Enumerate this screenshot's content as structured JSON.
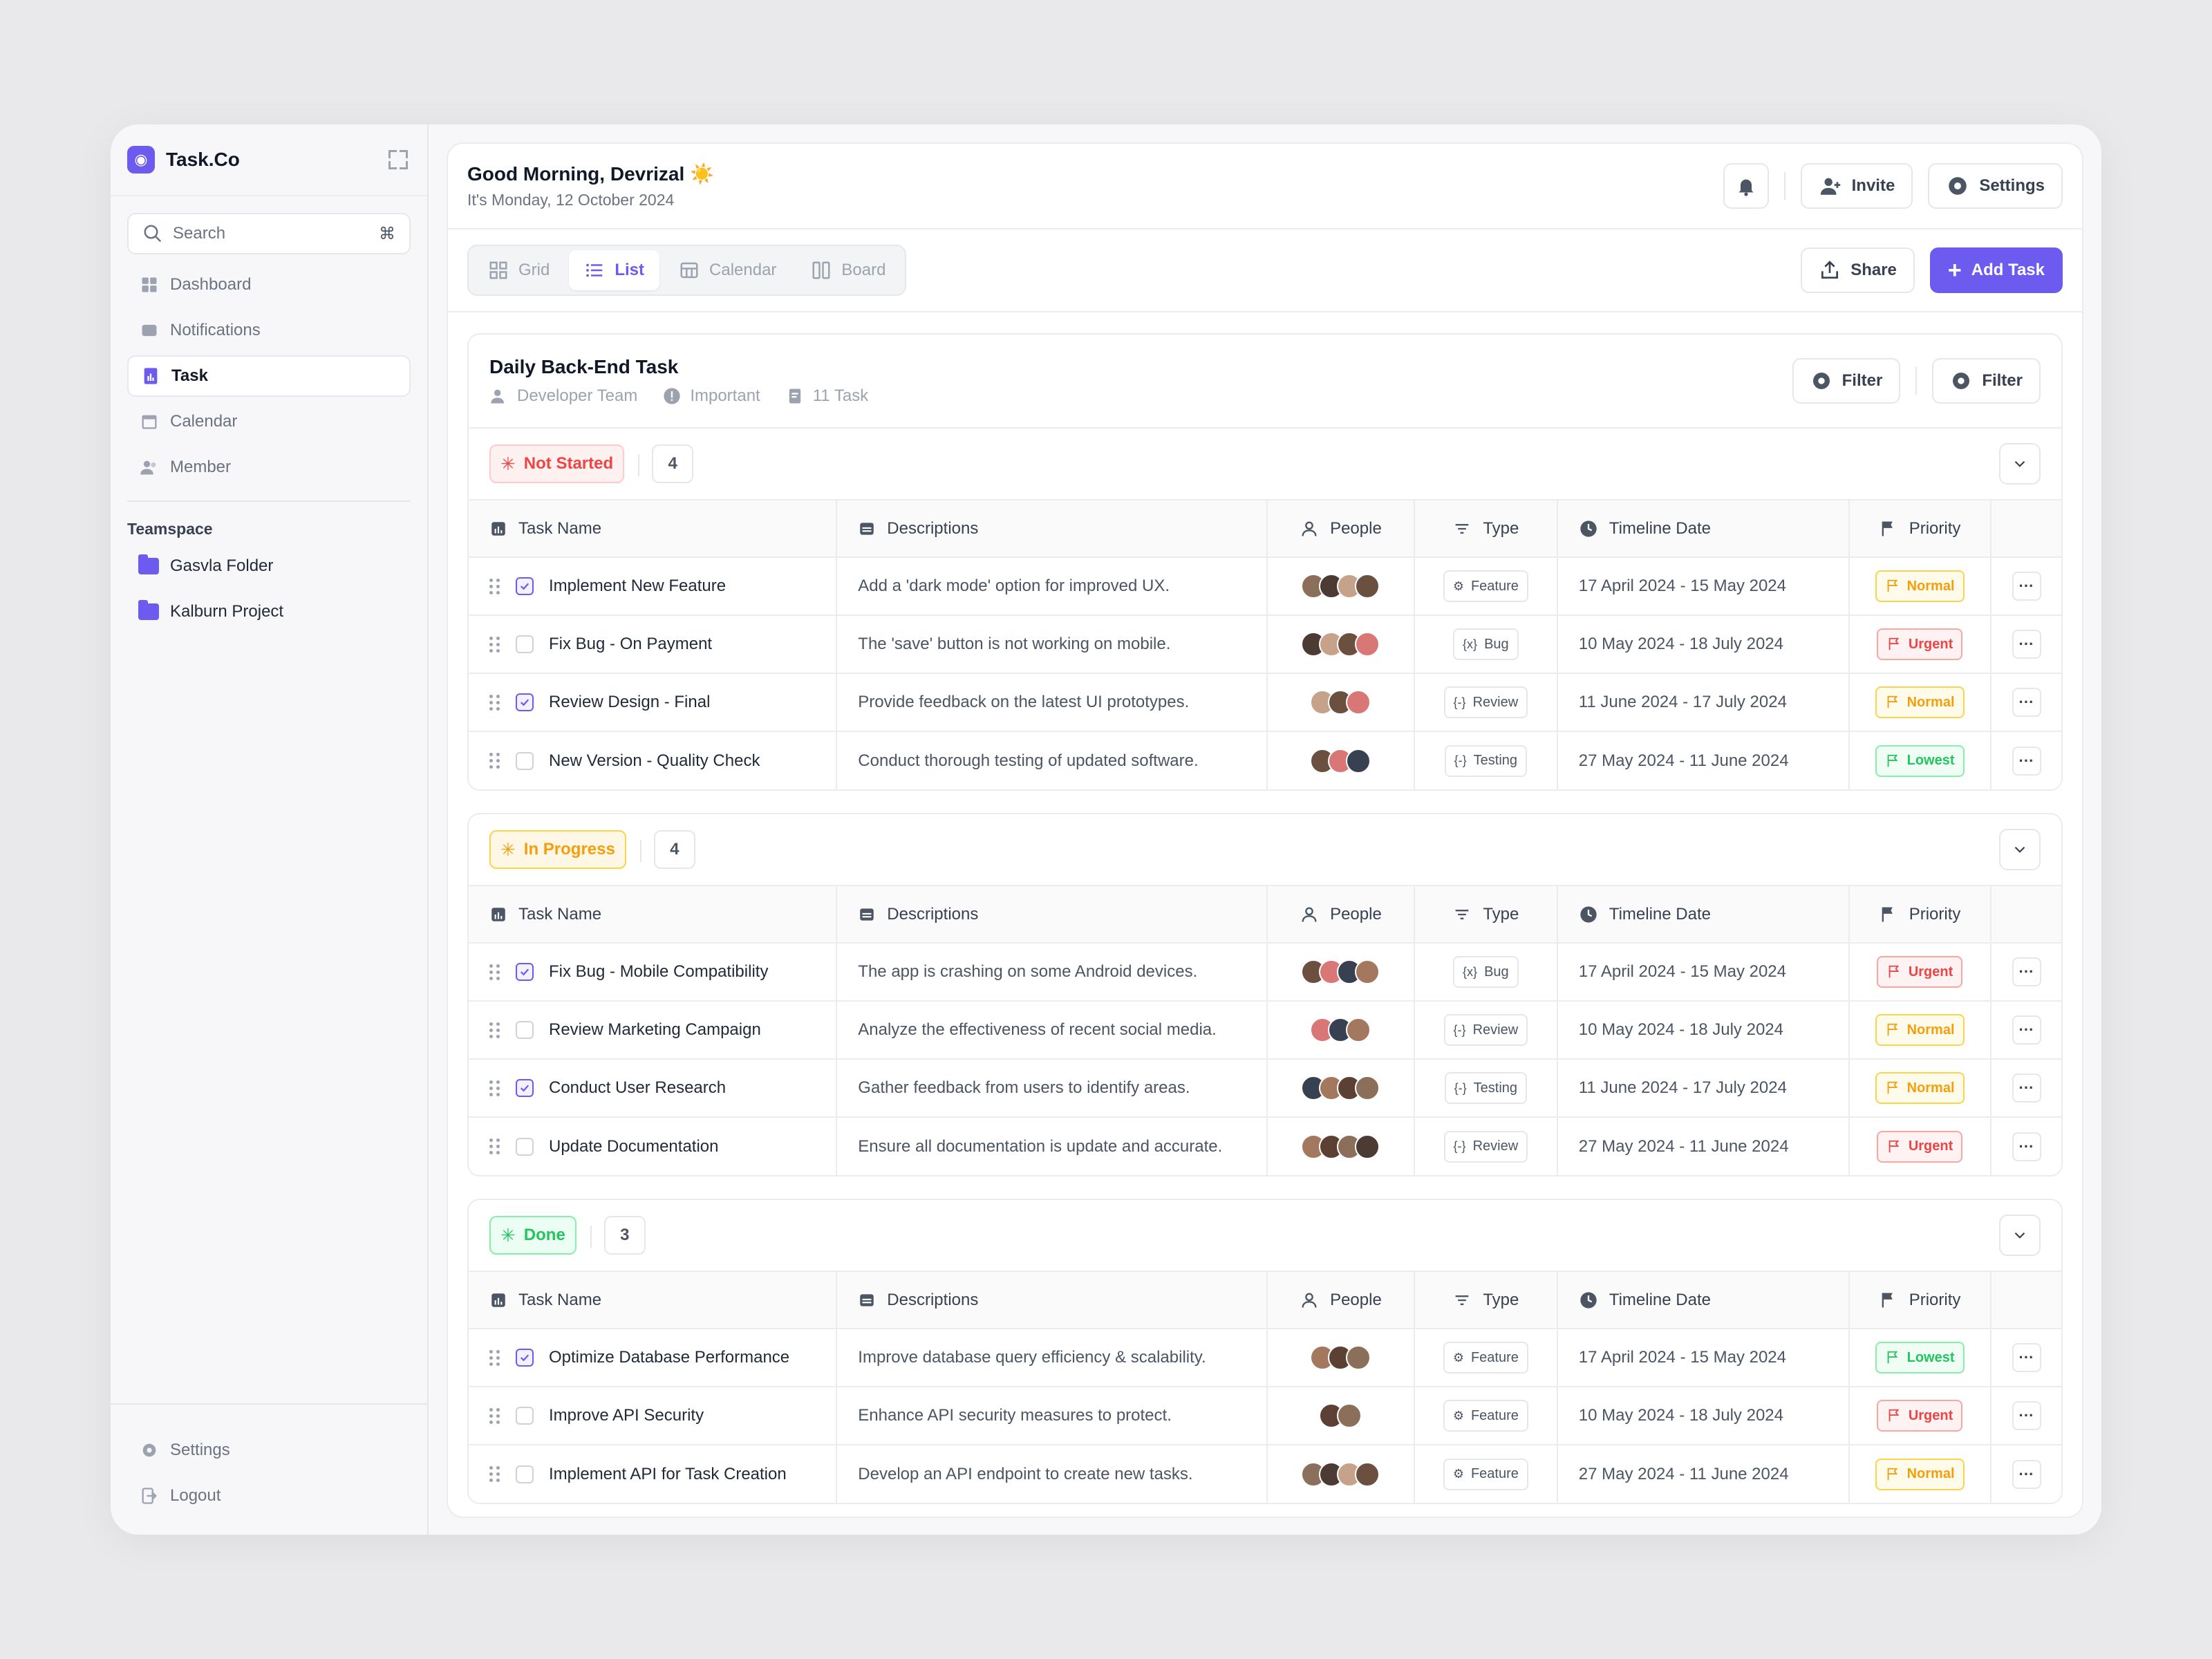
{
  "brand": {
    "name": "Task.Co"
  },
  "search": {
    "placeholder": "Search",
    "shortcut": "⌘"
  },
  "nav": [
    {
      "label": "Dashboard",
      "icon": "grid-icon"
    },
    {
      "label": "Notifications",
      "icon": "inbox-icon"
    },
    {
      "label": "Task",
      "icon": "document-chart-icon",
      "active": true
    },
    {
      "label": "Calendar",
      "icon": "calendar-icon"
    },
    {
      "label": "Member",
      "icon": "users-icon"
    }
  ],
  "teamspace": {
    "title": "Teamspace",
    "folders": [
      "Gasvla Folder",
      "Kalburn Project"
    ]
  },
  "footer": {
    "settings": "Settings",
    "logout": "Logout"
  },
  "header": {
    "greeting": "Good Morning, Devrizal",
    "greeting_emoji": "☀️",
    "date": "It's Monday, 12 October 2024",
    "invite": "Invite",
    "settings": "Settings"
  },
  "views": {
    "tabs": [
      "Grid",
      "List",
      "Calendar",
      "Board"
    ],
    "active": "List",
    "share": "Share",
    "add_task": "Add Task"
  },
  "project": {
    "title": "Daily Back-End Task",
    "team": "Developer Team",
    "priority": "Important",
    "task_count": "11 Task",
    "filter1": "Filter",
    "filter2": "Filter"
  },
  "columns": {
    "name": "Task Name",
    "desc": "Descriptions",
    "people": "People",
    "type": "Type",
    "timeline": "Timeline Date",
    "priority": "Priority"
  },
  "colors": {
    "accent": "#6d5bf0",
    "normal": "#f59e0b",
    "urgent": "#ef4444",
    "lowest": "#22c55e"
  },
  "sections": [
    {
      "status": "Not Started",
      "count": "4",
      "tone": "red",
      "rows": [
        {
          "name": "Implement New Feature",
          "checked": true,
          "desc": "Add a 'dark mode' option for improved UX.",
          "avatars": 4,
          "type": "Feature",
          "timeline": "17 April 2024 - 15 May 2024",
          "priority": "Normal"
        },
        {
          "name": "Fix Bug - On Payment",
          "checked": false,
          "desc": "The 'save' button is not working on mobile.",
          "avatars": 4,
          "type": "Bug",
          "timeline": "10 May 2024 - 18 July 2024",
          "priority": "Urgent"
        },
        {
          "name": "Review Design - Final",
          "checked": true,
          "desc": "Provide feedback on the latest UI prototypes.",
          "avatars": 3,
          "type": "Review",
          "timeline": "11 June 2024 - 17 July 2024",
          "priority": "Normal"
        },
        {
          "name": "New Version - Quality Check",
          "checked": false,
          "desc": "Conduct thorough testing of updated software.",
          "avatars": 3,
          "type": "Testing",
          "timeline": "27 May 2024 - 11 June 2024",
          "priority": "Lowest"
        }
      ]
    },
    {
      "status": "In Progress",
      "count": "4",
      "tone": "amber",
      "rows": [
        {
          "name": "Fix Bug - Mobile Compatibility",
          "checked": true,
          "desc": "The app is crashing on some Android devices.",
          "avatars": 4,
          "type": "Bug",
          "timeline": "17 April 2024 - 15 May 2024",
          "priority": "Urgent"
        },
        {
          "name": "Review Marketing Campaign",
          "checked": false,
          "desc": "Analyze the effectiveness of recent social media.",
          "avatars": 3,
          "type": "Review",
          "timeline": "10 May 2024 - 18 July 2024",
          "priority": "Normal"
        },
        {
          "name": "Conduct User Research",
          "checked": true,
          "desc": "Gather feedback from users to identify areas.",
          "avatars": 4,
          "type": "Testing",
          "timeline": "11 June 2024 - 17 July 2024",
          "priority": "Normal"
        },
        {
          "name": "Update Documentation",
          "checked": false,
          "desc": "Ensure all documentation is update and accurate.",
          "avatars": 4,
          "type": "Review",
          "timeline": "27 May 2024 - 11 June 2024",
          "priority": "Urgent"
        }
      ]
    },
    {
      "status": "Done",
      "count": "3",
      "tone": "green",
      "rows": [
        {
          "name": "Optimize Database Performance",
          "checked": true,
          "desc": "Improve database query efficiency & scalability.",
          "avatars": 3,
          "type": "Feature",
          "timeline": "17 April 2024 - 15 May 2024",
          "priority": "Lowest"
        },
        {
          "name": "Improve API Security",
          "checked": false,
          "desc": "Enhance API security measures to protect.",
          "avatars": 2,
          "type": "Feature",
          "timeline": "10 May 2024 - 18 July 2024",
          "priority": "Urgent"
        },
        {
          "name": "Implement API for Task Creation",
          "checked": false,
          "desc": "Develop an API endpoint to create new tasks.",
          "avatars": 4,
          "type": "Feature",
          "timeline": "27 May 2024 - 11 June 2024",
          "priority": "Normal"
        }
      ]
    }
  ]
}
